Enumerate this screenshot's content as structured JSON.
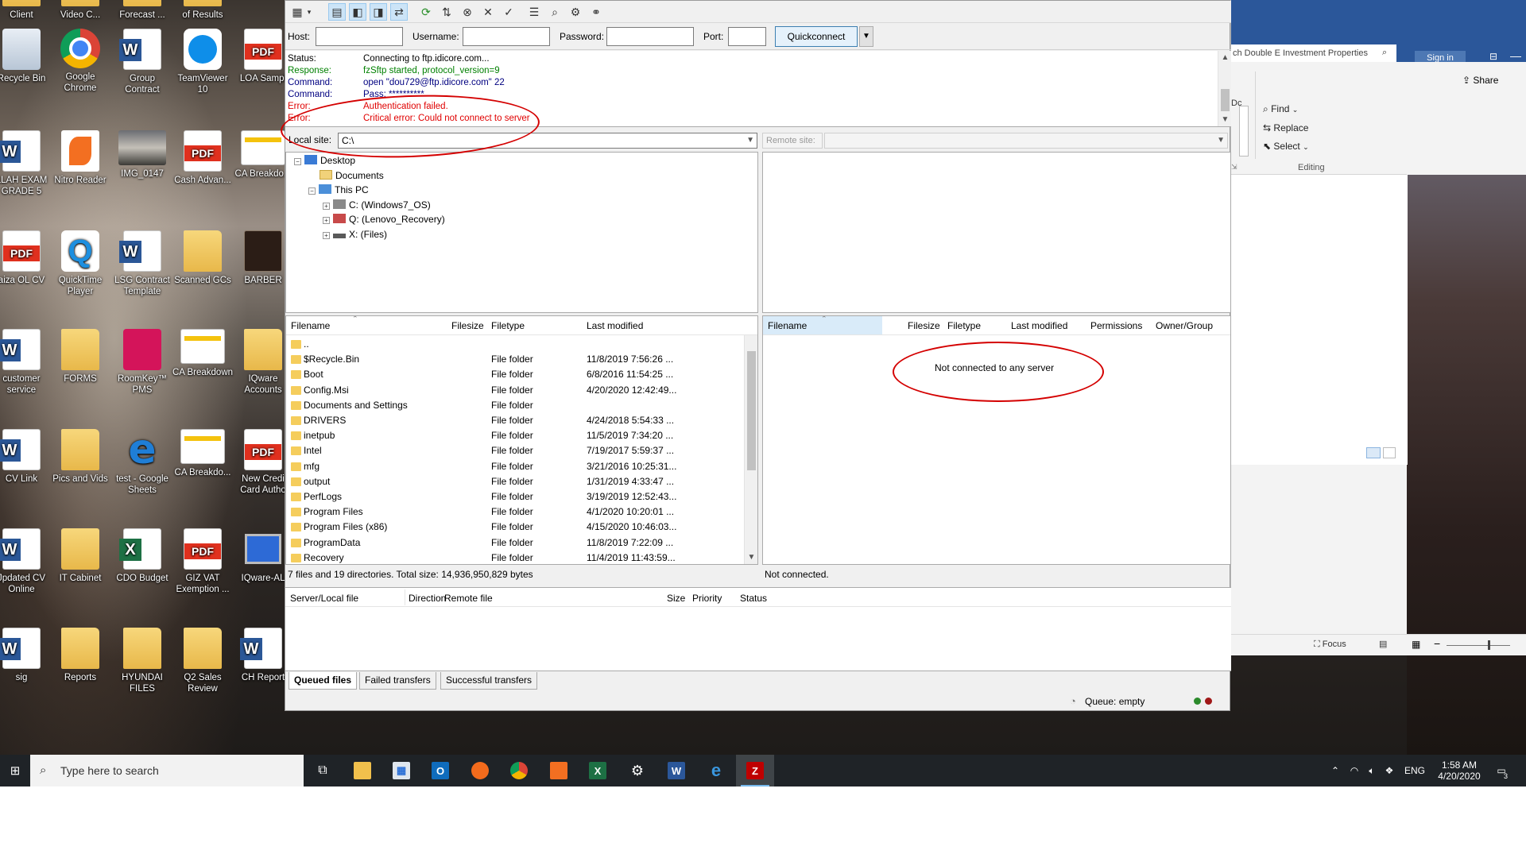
{
  "desktop": {
    "icons": [
      {
        "label": "Client",
        "type": "folder",
        "col": 0,
        "row": -1
      },
      {
        "label": "Video C...",
        "type": "folder",
        "col": 1,
        "row": -1
      },
      {
        "label": "Forecast ...",
        "type": "folder",
        "col": 2,
        "row": -1
      },
      {
        "label": "of Results",
        "type": "folder",
        "col": 3,
        "row": -1
      },
      {
        "label": "Recycle Bin",
        "type": "recycle",
        "col": 0,
        "row": 0
      },
      {
        "label": "Google Chrome",
        "type": "chrome",
        "col": 1,
        "row": 0
      },
      {
        "label": "Group Contract",
        "type": "word",
        "col": 2,
        "row": 0
      },
      {
        "label": "TeamViewer 10",
        "type": "teamviewer",
        "col": 3,
        "row": 0
      },
      {
        "label": "LOA Sampl",
        "type": "pdf",
        "col": 4,
        "row": 0
      },
      {
        "label": "LLAH EXAM GRADE 5",
        "type": "word",
        "col": 0,
        "row": 1
      },
      {
        "label": "Nitro Reader",
        "type": "nitro",
        "col": 1,
        "row": 1
      },
      {
        "label": "IMG_0147",
        "type": "photo",
        "col": 2,
        "row": 1
      },
      {
        "label": "Cash Advan...",
        "type": "pdf",
        "col": 3,
        "row": 1
      },
      {
        "label": "CA Breakdo...",
        "type": "sheet",
        "col": 4,
        "row": 1
      },
      {
        "label": "aiza OL CV",
        "type": "pdf",
        "col": 0,
        "row": 2
      },
      {
        "label": "QuickTime Player",
        "type": "quick",
        "col": 1,
        "row": 2
      },
      {
        "label": "LSG Contract Template",
        "type": "word",
        "col": 2,
        "row": 2
      },
      {
        "label": "Scanned GCs",
        "type": "folder",
        "col": 3,
        "row": 2
      },
      {
        "label": "BARBER",
        "type": "book",
        "col": 4,
        "row": 2
      },
      {
        "label": "customer service",
        "type": "word",
        "col": 0,
        "row": 3
      },
      {
        "label": "FORMS",
        "type": "folder",
        "col": 1,
        "row": 3
      },
      {
        "label": "RoomKey™ PMS",
        "type": "roomkey",
        "col": 2,
        "row": 3
      },
      {
        "label": "CA Breakdown",
        "type": "sheet",
        "col": 3,
        "row": 3
      },
      {
        "label": "IQware Accounts",
        "type": "folder",
        "col": 4,
        "row": 3
      },
      {
        "label": "CV Link",
        "type": "word",
        "col": 0,
        "row": 4
      },
      {
        "label": "Pics and Vids",
        "type": "folder",
        "col": 1,
        "row": 4
      },
      {
        "label": "test - Google Sheets",
        "type": "edge",
        "col": 2,
        "row": 4
      },
      {
        "label": "CA Breakdo...",
        "type": "sheet",
        "col": 3,
        "row": 4
      },
      {
        "label": "New Credi Card Autho",
        "type": "pdf",
        "col": 4,
        "row": 4
      },
      {
        "label": "Jpdated CV Online",
        "type": "word",
        "col": 0,
        "row": 5
      },
      {
        "label": "IT Cabinet",
        "type": "cabinet",
        "col": 1,
        "row": 5
      },
      {
        "label": "CDO Budget",
        "type": "excel",
        "col": 2,
        "row": 5
      },
      {
        "label": "GIZ VAT Exemption ...",
        "type": "pdf",
        "col": 3,
        "row": 5
      },
      {
        "label": "IQware-AL",
        "type": "computer",
        "col": 4,
        "row": 5
      },
      {
        "label": "sig",
        "type": "word",
        "col": 0,
        "row": 6
      },
      {
        "label": "Reports",
        "type": "folder",
        "col": 1,
        "row": 6
      },
      {
        "label": "HYUNDAI FILES",
        "type": "folder",
        "col": 2,
        "row": 6
      },
      {
        "label": "Q2 Sales Review",
        "type": "folder",
        "col": 3,
        "row": 6
      },
      {
        "label": "CH Report",
        "type": "word",
        "col": 4,
        "row": 6
      }
    ]
  },
  "word": {
    "search_partial": "ch Double E Investment Properties",
    "sign_in": "Sign in",
    "share": "Share",
    "find": "Find",
    "replace": "Replace",
    "select": "Select",
    "editing": "Editing",
    "focus": "Focus",
    "partial_letters": "Dc"
  },
  "filezilla": {
    "quickconnect": {
      "host_label": "Host:",
      "username_label": "Username:",
      "password_label": "Password:",
      "port_label": "Port:",
      "host_value": "",
      "username_value": "",
      "password_value": "",
      "port_value": "",
      "button": "Quickconnect"
    },
    "log": [
      {
        "type": "Status:",
        "text": "Connecting to ftp.idicore.com...",
        "cls": "st"
      },
      {
        "type": "Response:",
        "text": "fzSftp started, protocol_version=9",
        "cls": "rs"
      },
      {
        "type": "Command:",
        "text": "open \"dou729@ftp.idicore.com\" 22",
        "cls": "cm"
      },
      {
        "type": "Command:",
        "text": "Pass: **********",
        "cls": "cm"
      },
      {
        "type": "Error:",
        "text": "Authentication failed.",
        "cls": "er"
      },
      {
        "type": "Error:",
        "text": "Critical error: Could not connect to server",
        "cls": "er"
      }
    ],
    "local_site_label": "Local site:",
    "local_site_value": "C:\\",
    "remote_site_label": "Remote site:",
    "tree": [
      {
        "label": "Desktop",
        "level": 0,
        "exp": "-",
        "icon": "desktop"
      },
      {
        "label": "Documents",
        "level": 1,
        "exp": "",
        "icon": "docs"
      },
      {
        "label": "This PC",
        "level": 1,
        "exp": "-",
        "icon": "pc"
      },
      {
        "label": "C: (Windows7_OS)",
        "level": 2,
        "exp": "+",
        "icon": "drive"
      },
      {
        "label": "Q: (Lenovo_Recovery)",
        "level": 2,
        "exp": "+",
        "icon": "drive2"
      },
      {
        "label": "X: (Files)",
        "level": 2,
        "exp": "+",
        "icon": "drive3"
      }
    ],
    "local_headers": {
      "filename": "Filename",
      "filesize": "Filesize",
      "filetype": "Filetype",
      "modified": "Last modified"
    },
    "local_files": [
      {
        "name": "..",
        "type": "",
        "modified": ""
      },
      {
        "name": "$Recycle.Bin",
        "type": "File folder",
        "modified": "11/8/2019 7:56:26 ..."
      },
      {
        "name": "Boot",
        "type": "File folder",
        "modified": "6/8/2016 11:54:25 ..."
      },
      {
        "name": "Config.Msi",
        "type": "File folder",
        "modified": "4/20/2020 12:42:49..."
      },
      {
        "name": "Documents and Settings",
        "type": "File folder",
        "modified": ""
      },
      {
        "name": "DRIVERS",
        "type": "File folder",
        "modified": "4/24/2018 5:54:33 ..."
      },
      {
        "name": "inetpub",
        "type": "File folder",
        "modified": "11/5/2019 7:34:20 ..."
      },
      {
        "name": "Intel",
        "type": "File folder",
        "modified": "7/19/2017 5:59:37 ..."
      },
      {
        "name": "mfg",
        "type": "File folder",
        "modified": "3/21/2016 10:25:31..."
      },
      {
        "name": "output",
        "type": "File folder",
        "modified": "1/31/2019 4:33:47 ..."
      },
      {
        "name": "PerfLogs",
        "type": "File folder",
        "modified": "3/19/2019 12:52:43..."
      },
      {
        "name": "Program Files",
        "type": "File folder",
        "modified": "4/1/2020 10:20:01 ..."
      },
      {
        "name": "Program Files (x86)",
        "type": "File folder",
        "modified": "4/15/2020 10:46:03..."
      },
      {
        "name": "ProgramData",
        "type": "File folder",
        "modified": "11/8/2019 7:22:09 ..."
      },
      {
        "name": "Recovery",
        "type": "File folder",
        "modified": "11/4/2019 11:43:59..."
      }
    ],
    "local_status": "7 files and 19 directories. Total size: 14,936,950,829 bytes",
    "remote_headers": {
      "filename": "Filename",
      "filesize": "Filesize",
      "filetype": "Filetype",
      "modified": "Last modified",
      "permissions": "Permissions",
      "owner": "Owner/Group"
    },
    "remote_empty": "Not connected to any server",
    "remote_status": "Not connected.",
    "queue_headers": {
      "server": "Server/Local file",
      "direction": "Direction",
      "remote": "Remote file",
      "size": "Size",
      "priority": "Priority",
      "status": "Status"
    },
    "queue_tabs": [
      "Queued files",
      "Failed transfers",
      "Successful transfers"
    ],
    "queue_status": "Queue: empty"
  },
  "taskbar": {
    "search_placeholder": "Type here to search",
    "language": "ENG",
    "time": "1:58 AM",
    "date": "4/20/2020",
    "notification_count": "3"
  },
  "colors": {
    "error": "#e00000",
    "response": "#008000",
    "command": "#000080",
    "annotation": "#d40000",
    "taskbar": "#1f2327"
  }
}
